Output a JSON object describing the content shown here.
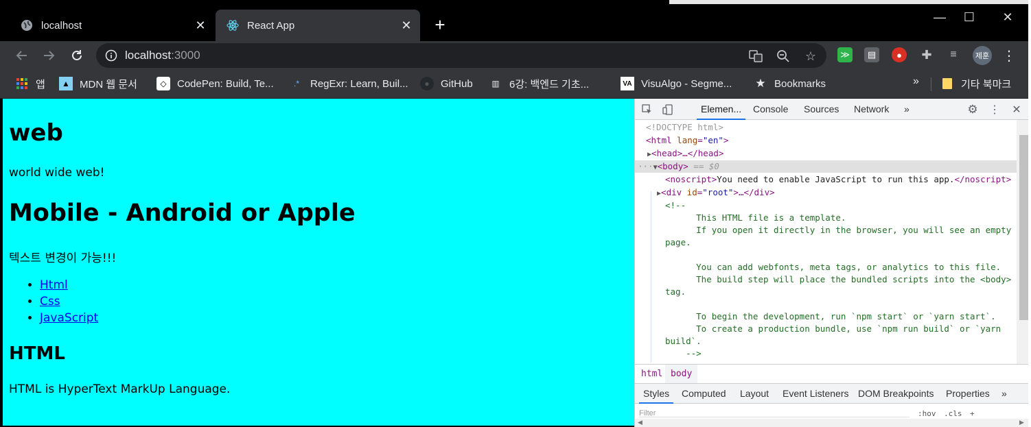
{
  "browser": {
    "tabs": [
      {
        "title": "localhost",
        "active": false
      },
      {
        "title": "React App",
        "active": true
      }
    ],
    "new_tab": "+",
    "window_controls": {
      "minimize": "—",
      "maximize": "☐",
      "close": "✕"
    },
    "address": {
      "host": "localhost",
      "port": ":3000"
    },
    "profile_initials": "제훈",
    "bookmarks": [
      {
        "label": "앱",
        "icon": "apps-grid-icon"
      },
      {
        "label": "MDN 웹 문서",
        "icon": "mdn-icon"
      },
      {
        "label": "CodePen: Build, Te...",
        "icon": "codepen-icon"
      },
      {
        "label": "RegExr: Learn, Buil...",
        "icon": "regexr-icon"
      },
      {
        "label": "GitHub",
        "icon": "github-icon"
      },
      {
        "label": "6강: 백엔드 기초...",
        "icon": "book-icon"
      },
      {
        "label": "VisuAlgo - Segme...",
        "icon": "visualgo-icon"
      },
      {
        "label": "Bookmarks",
        "icon": "star-icon"
      },
      {
        "label": "기타 북마크",
        "icon": "folder-icon"
      }
    ],
    "bookmarks_more": "»"
  },
  "page": {
    "heading_web": "web",
    "text_web": "world wide web!",
    "heading_mobile": "Mobile - Android or Apple",
    "text_korean": "텍스트 변경이 가능!!!",
    "links": [
      "Html",
      "Css",
      "JavaScript"
    ],
    "heading_html": "HTML",
    "text_html": "HTML is HyperText MarkUp Language.",
    "background_color": "#00ffff"
  },
  "devtools": {
    "tabs": [
      "Elemen...",
      "Console",
      "Sources",
      "Network",
      "»"
    ],
    "dom": {
      "doctype": "<!DOCTYPE html>",
      "html_open_tag": "html",
      "html_attr": "lang",
      "html_attr_val": "\"en\"",
      "head": "<head>…</head>",
      "body_tag": "<body>",
      "body_suffix": " == $0",
      "noscript_open": "<noscript>",
      "noscript_text": "You need to enable JavaScript to run this app.",
      "noscript_close": "</noscript>",
      "div_tag": "div",
      "div_attr": "id",
      "div_attr_val": "\"root\"",
      "div_rest": ">…</div>",
      "comment_lines": [
        "<!--",
        "      This HTML file is a template.",
        "      If you open it directly in the browser, you will see an empty",
        "page.",
        "",
        "      You can add webfonts, meta tags, or analytics to this file.",
        "      The build step will place the bundled scripts into the <body>",
        "tag.",
        "",
        "      To begin the development, run `npm start` or `yarn start`.",
        "      To create a production bundle, use `npm run build` or `yarn",
        "build`.",
        "    -->"
      ]
    },
    "breadcrumbs": [
      "html",
      "body"
    ],
    "styles_tabs": [
      "Styles",
      "Computed",
      "Layout",
      "Event Listeners",
      "DOM Breakpoints",
      "Properties",
      "»"
    ],
    "filter_placeholder": "Filter",
    "filter_buttons": [
      ":hov",
      ".cls",
      "+"
    ]
  }
}
